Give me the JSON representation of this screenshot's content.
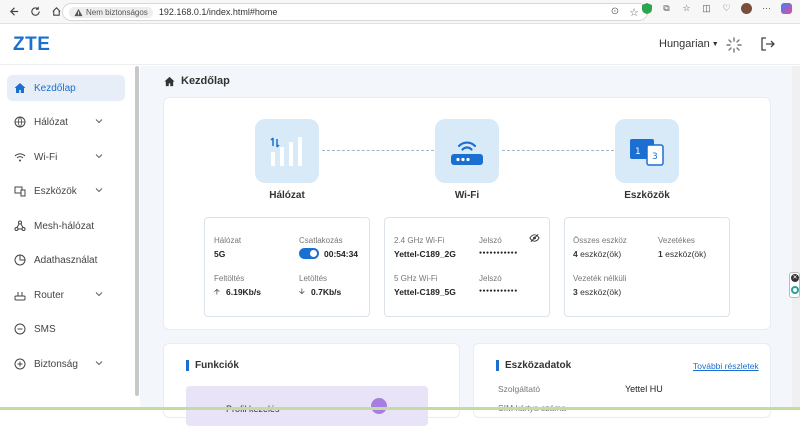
{
  "browser": {
    "security_label": "Nem biztonságos",
    "url": "192.168.0.1/index.html#home"
  },
  "header": {
    "logo": "ZTE",
    "language": "Hungarian"
  },
  "sidebar": {
    "items": [
      {
        "label": "Kezdőlap",
        "icon": "home-icon",
        "active": true,
        "expandable": false
      },
      {
        "label": "Hálózat",
        "icon": "globe-icon",
        "expandable": true
      },
      {
        "label": "Wi-Fi",
        "icon": "wifi-icon",
        "expandable": true
      },
      {
        "label": "Eszközök",
        "icon": "devices-icon",
        "expandable": true
      },
      {
        "label": "Mesh-hálózat",
        "icon": "mesh-icon",
        "expandable": false
      },
      {
        "label": "Adathasználat",
        "icon": "data-usage-icon",
        "expandable": false
      },
      {
        "label": "Router",
        "icon": "router-icon",
        "expandable": true
      },
      {
        "label": "SMS",
        "icon": "sms-icon",
        "expandable": false
      },
      {
        "label": "Biztonság",
        "icon": "shield-icon",
        "expandable": true
      }
    ]
  },
  "main": {
    "title": "Kezdőlap",
    "tiles": {
      "network": "Hálózat",
      "wifi": "Wi-Fi",
      "devices": "Eszközök"
    },
    "network_card": {
      "network_label": "Hálózat",
      "network_value": "5G",
      "connection_label": "Csatlakozás",
      "connection_time": "00:54:34",
      "upload_label": "Feltöltés",
      "upload_value": "6.19Kb/s",
      "download_label": "Letöltés",
      "download_value": "0.7Kb/s"
    },
    "wifi_card": {
      "band1_label": "2.4 GHz Wi-Fi",
      "band1_ssid": "Yettel-C189_2G",
      "band1_pw_label": "Jelszó",
      "band1_pw": "●●●●●●●●●●●",
      "band2_label": "5 GHz Wi-Fi",
      "band2_ssid": "Yettel-C189_5G",
      "band2_pw_label": "Jelszó",
      "band2_pw": "●●●●●●●●●●●"
    },
    "devices_card": {
      "total_label": "Összes eszköz",
      "total_count": "4",
      "total_unit": "eszköz(ök)",
      "wired_label": "Vezetékes",
      "wired_count": "1",
      "wired_unit": "eszköz(ök)",
      "wireless_label": "Vezeték nélküli",
      "wireless_count": "3",
      "wireless_unit": "eszköz(ök)"
    },
    "functions": {
      "title": "Funkciók",
      "item_partial": "Profil kezelés"
    },
    "device_data": {
      "title": "Eszközadatok",
      "more_link": "További részletek",
      "provider_label": "Szolgáltató",
      "provider_value": "Yettel HU",
      "sim_label": "SIM kártya száma"
    }
  }
}
